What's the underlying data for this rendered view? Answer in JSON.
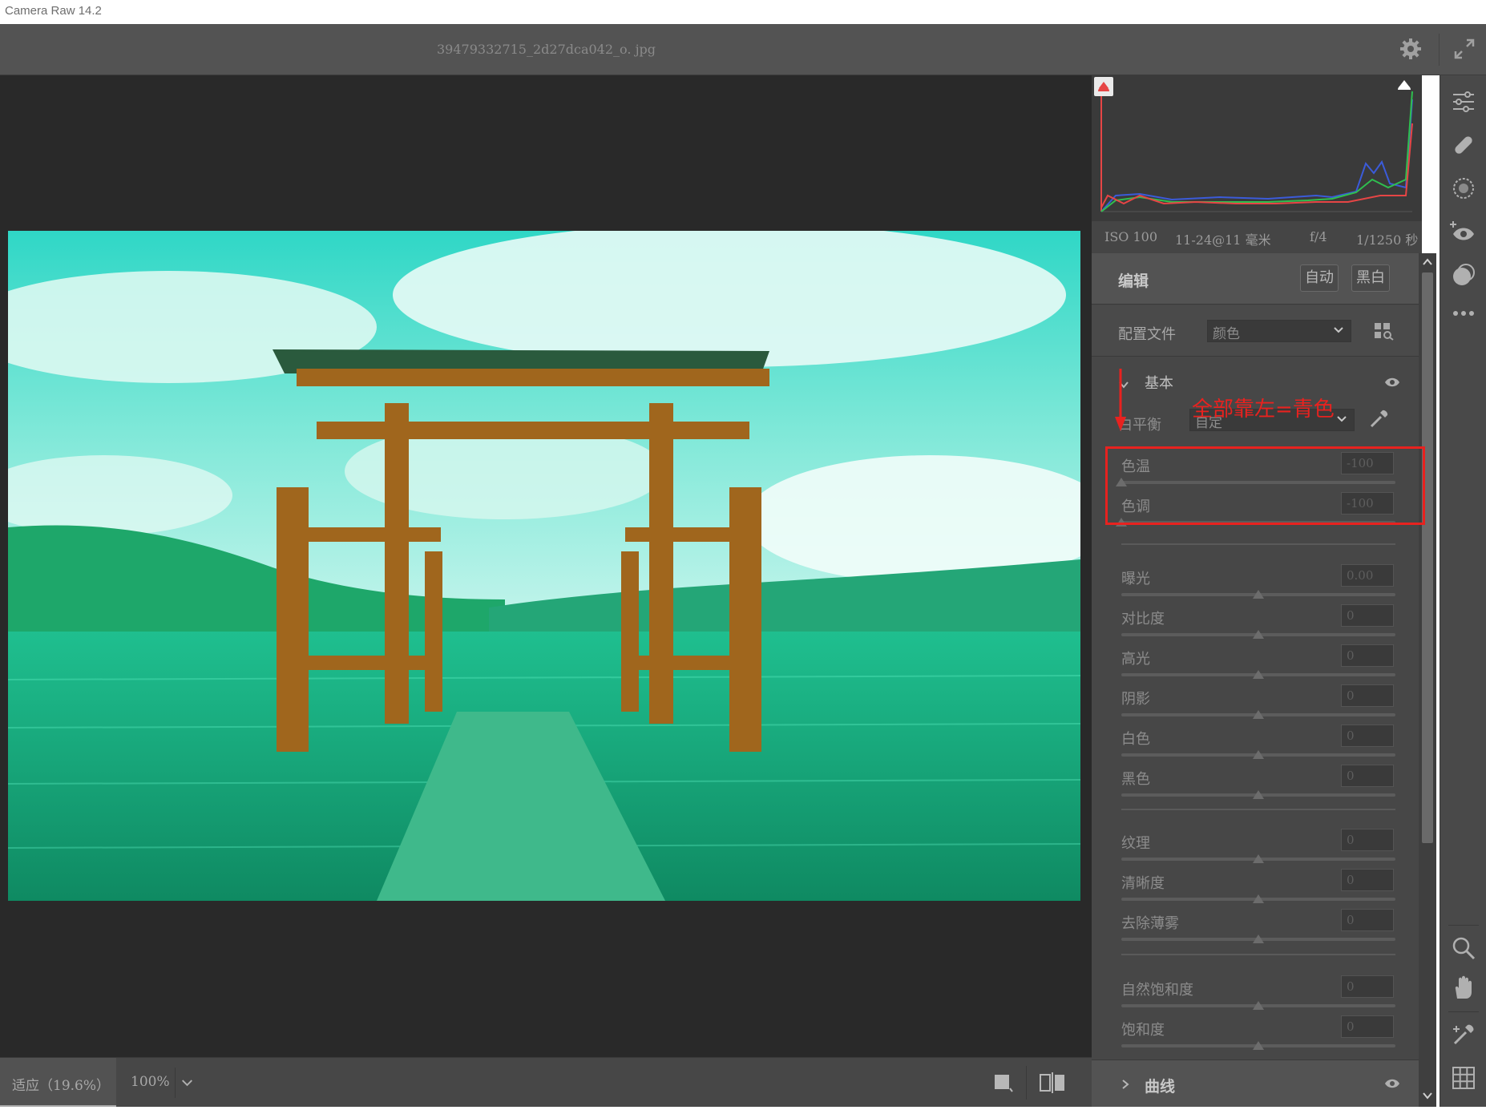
{
  "app": {
    "title": "Camera Raw 14.2"
  },
  "header": {
    "filename": "39479332715_2d27dca042_o. jpg"
  },
  "exif": {
    "iso": "ISO 100",
    "lens": "11-24@11 毫米",
    "aperture": "f/4",
    "shutter": "1/1250 秒"
  },
  "edit": {
    "label": "编辑",
    "auto": "自动",
    "bw": "黑白"
  },
  "profile": {
    "label": "配置文件",
    "value": "颜色"
  },
  "basic": {
    "label": "基本",
    "wb_label": "白平衡",
    "wb_value": "自定",
    "temp": {
      "label": "色温",
      "value": "-100"
    },
    "tint": {
      "label": "色调",
      "value": "-100"
    },
    "sliders_tone": [
      {
        "label": "曝光",
        "value": "0.00"
      },
      {
        "label": "对比度",
        "value": "0"
      },
      {
        "label": "高光",
        "value": "0"
      },
      {
        "label": "阴影",
        "value": "0"
      },
      {
        "label": "白色",
        "value": "0"
      },
      {
        "label": "黑色",
        "value": "0"
      }
    ],
    "sliders_presence": [
      {
        "label": "纹理",
        "value": "0"
      },
      {
        "label": "清晰度",
        "value": "0"
      },
      {
        "label": "去除薄雾",
        "value": "0"
      }
    ],
    "sliders_color": [
      {
        "label": "自然饱和度",
        "value": "0"
      },
      {
        "label": "饱和度",
        "value": "0"
      }
    ]
  },
  "curve": {
    "label": "曲线"
  },
  "annotation": {
    "text": "全部靠左=青色"
  },
  "bottom": {
    "fit": "适应（19.6%）",
    "zoom": "100%"
  },
  "icons": {
    "settings": "gear-icon",
    "fullscreen": "expand-icon",
    "visibility": "eye-icon",
    "eyedropper": "eyedropper-icon",
    "profile_browser": "grid-search-icon",
    "edit_tool": "sliders-icon",
    "heal": "bandage-icon",
    "mask": "mask-icon",
    "redeye": "redeye-icon",
    "presets": "presets-icon",
    "more": "more-icon",
    "zoom": "zoom-icon",
    "hand": "hand-icon",
    "sampler": "color-sampler-icon",
    "grid": "grid-icon"
  },
  "colors": {
    "annotation": "#e8221f",
    "clip_shadow": "#e64545",
    "clip_highlight": "#ffffff"
  }
}
